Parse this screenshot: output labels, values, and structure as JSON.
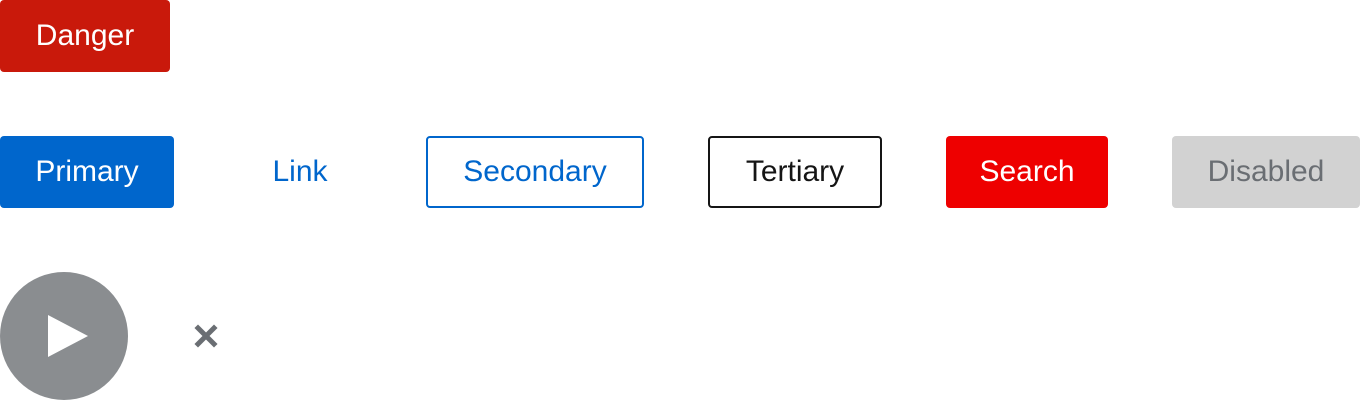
{
  "buttons": {
    "danger": "Danger",
    "primary": "Primary",
    "link": "Link",
    "secondary": "Secondary",
    "tertiary": "Tertiary",
    "search": "Search",
    "disabled": "Disabled"
  },
  "icons": {
    "play": "play-icon",
    "close": "close-icon"
  },
  "colors": {
    "danger": "#c9190b",
    "primary": "#0066cc",
    "search": "#ee0000",
    "disabled_bg": "#d2d2d2",
    "disabled_text": "#6a6e73",
    "play_bg": "#8a8d90",
    "close_icon": "#6a6e73"
  }
}
